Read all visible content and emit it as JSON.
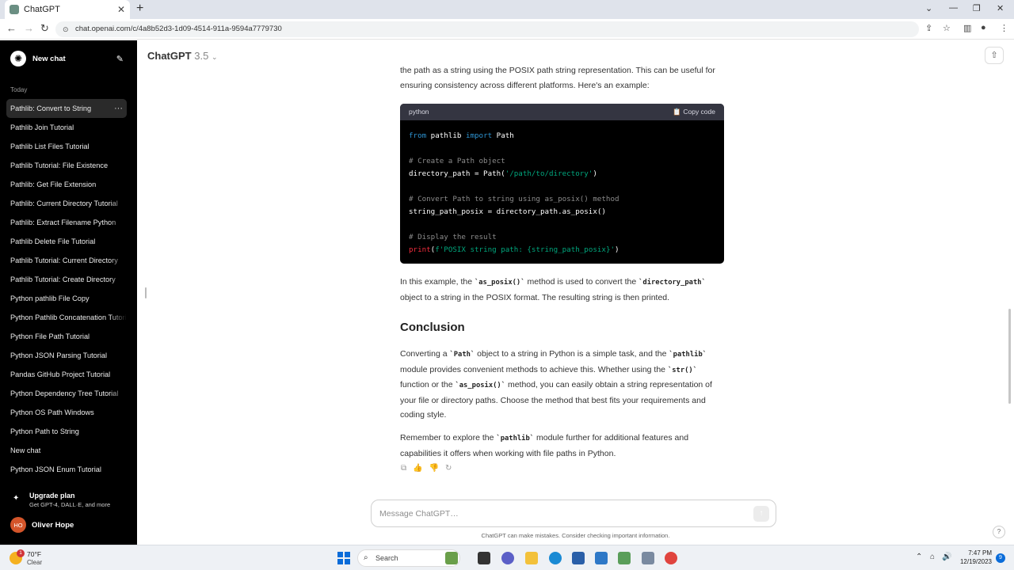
{
  "browser": {
    "tab_title": "ChatGPT",
    "tab_close": "✕",
    "new_tab": "+",
    "url": "chat.openai.com/c/4a8b52d3-1d09-4514-911a-9594a7779730",
    "window_controls": {
      "dropdown": "⌄",
      "minimize": "—",
      "restore": "❐",
      "close": "✕"
    },
    "nav": {
      "back": "←",
      "forward": "→",
      "reload": "↻",
      "lock": "⊙"
    },
    "toolbar_icons": {
      "share": "⇪",
      "bookmark": "☆",
      "sidepanel": "▥",
      "profile": "●",
      "menu": "⋮"
    }
  },
  "sidebar": {
    "new_chat_label": "New chat",
    "logo_glyph": "✺",
    "edit_glyph": "✎",
    "section_today": "Today",
    "more_glyph": "···",
    "items": [
      {
        "label": "Pathlib: Convert to String"
      },
      {
        "label": "Pathlib Join Tutorial"
      },
      {
        "label": "Pathlib List Files Tutorial"
      },
      {
        "label": "Pathlib Tutorial: File Existence"
      },
      {
        "label": "Pathlib: Get File Extension"
      },
      {
        "label": "Pathlib: Current Directory Tutorial"
      },
      {
        "label": "Pathlib: Extract Filename Python"
      },
      {
        "label": "Pathlib Delete File Tutorial"
      },
      {
        "label": "Pathlib Tutorial: Current Directory"
      },
      {
        "label": "Pathlib Tutorial: Create Directory"
      },
      {
        "label": "Python pathlib File Copy"
      },
      {
        "label": "Python Pathlib Concatenation Tutorial"
      },
      {
        "label": "Python File Path Tutorial"
      },
      {
        "label": "Python JSON Parsing Tutorial"
      },
      {
        "label": "Pandas GitHub Project Tutorial"
      },
      {
        "label": "Python Dependency Tree Tutorial"
      },
      {
        "label": "Python OS Path Windows"
      },
      {
        "label": "Python Path to String"
      },
      {
        "label": "New chat"
      },
      {
        "label": "Python JSON Enum Tutorial"
      }
    ],
    "upgrade": {
      "glyph": "✦",
      "title": "Upgrade plan",
      "subtitle": "Get GPT-4, DALL·E, and more"
    },
    "user": {
      "initials": "HO",
      "name": "Oliver Hope"
    }
  },
  "header": {
    "model_name": "ChatGPT",
    "model_version": "3.5",
    "caret": "⌄",
    "share_glyph": "⇧"
  },
  "message": {
    "intro": "the path as a string using the POSIX path string representation. This can be useful for ensuring consistency across different platforms. Here's an example:",
    "code": {
      "language": "python",
      "copy_label": "📋 Copy code",
      "l1_kw1": "from",
      "l1_mod": " pathlib ",
      "l1_kw2": "import",
      "l1_name": " Path",
      "l2_comment": "# Create a Path object",
      "l3_a": "directory_path = Path(",
      "l3_str": "'/path/to/directory'",
      "l3_b": ")",
      "l4_comment": "# Convert Path to string using as_posix() method",
      "l5": "string_path_posix = directory_path.as_posix()",
      "l6_comment": "# Display the result",
      "l7_fn": "print",
      "l7_open": "(",
      "l7_str": "f'POSIX string path: {string_path_posix}'",
      "l7_close": ")"
    },
    "p2": {
      "t1": "In this example, the ",
      "c1": "`as_posix()`",
      "t2": " method is used to convert the ",
      "c2": "`directory_path`",
      "t3": " object to a string in the POSIX format. The resulting string is then printed."
    },
    "heading": "Conclusion",
    "p3": {
      "t1": "Converting a ",
      "c1": "`Path`",
      "t2": " object to a string in Python is a simple task, and the ",
      "c2": "`pathlib`",
      "t3": " module provides convenient methods to achieve this. Whether using the ",
      "c3": "`str()`",
      "t4": " function or the ",
      "c4": "`as_posix()`",
      "t5": " method, you can easily obtain a string representation of your file or directory paths. Choose the method that best fits your requirements and coding style."
    },
    "p4": {
      "t1": "Remember to explore the ",
      "c1": "`pathlib`",
      "t2": " module further for additional features and capabilities it offers when working with file paths in Python."
    },
    "actions": {
      "copy": "⧉",
      "thumbs_up": "👍",
      "thumbs_down": "👎",
      "regenerate": "↻"
    }
  },
  "composer": {
    "placeholder": "Message ChatGPT…",
    "send_glyph": "↑",
    "disclaimer": "ChatGPT can make mistakes. Consider checking important information.",
    "help": "?"
  },
  "taskbar": {
    "weather_badge": "1",
    "temperature": "70°F",
    "condition": "Clear",
    "search_label": "Search",
    "search_glyph": "⌕",
    "tray": {
      "chevron": "⌃",
      "network": "⌂",
      "volume": "🔊",
      "battery": "▭"
    },
    "time": "7:47 PM",
    "date": "12/19/2023",
    "notifications": "9"
  },
  "colors": {
    "sidebar_bg": "#000000",
    "code_bg": "#000000",
    "code_header_bg": "#343541",
    "keyword": "#2e95d3",
    "string": "#00a67d",
    "function": "#f22c3d",
    "comment": "#8b8b8b",
    "avatar": "#d4552a",
    "taskbar_bg": "#eef1f5"
  }
}
